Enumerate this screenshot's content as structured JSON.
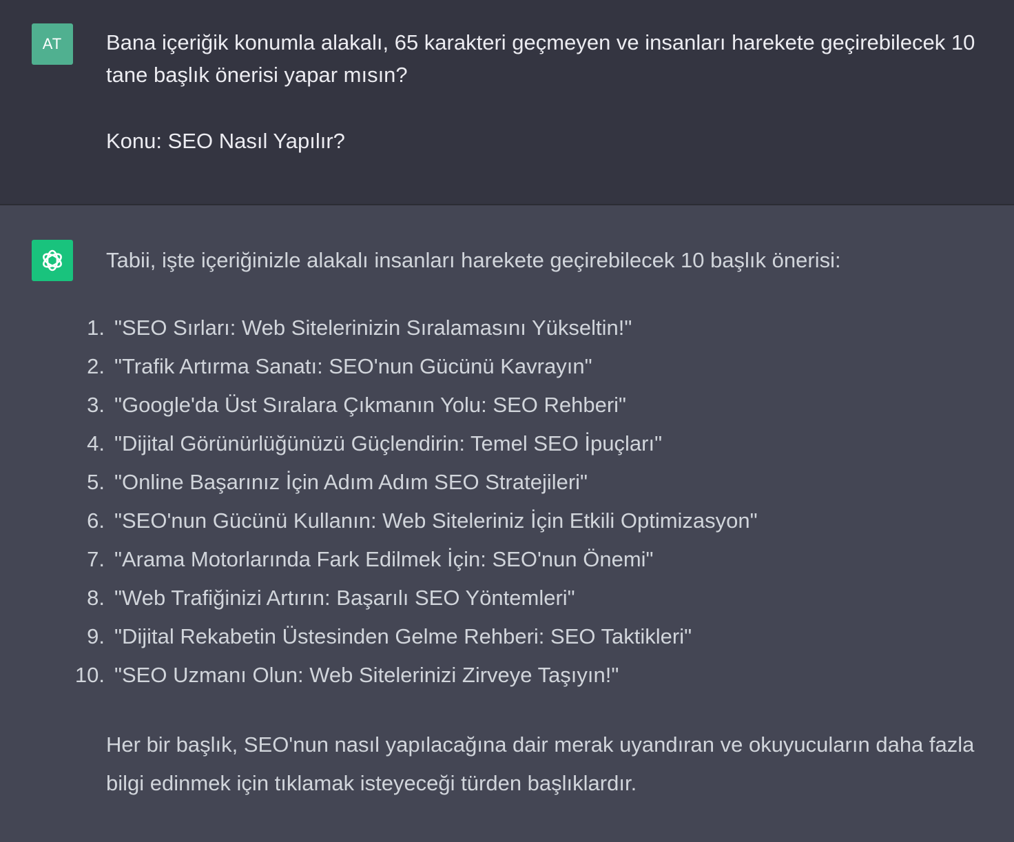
{
  "user_message": {
    "avatar_initials": "AT",
    "paragraph1": "Bana içeriğik konumla alakalı, 65 karakteri geçmeyen ve insanları harekete geçirebilecek 10 tane başlık önerisi yapar mısın?",
    "paragraph2": "Konu: SEO Nasıl Yapılır?"
  },
  "assistant_message": {
    "avatar_icon": "openai-logo-icon",
    "intro": "Tabii, işte içeriğinizle alakalı insanları harekete geçirebilecek 10 başlık önerisi:",
    "titles": [
      {
        "num": "1.",
        "text": "\"SEO Sırları: Web Sitelerinizin Sıralamasını Yükseltin!\""
      },
      {
        "num": "2.",
        "text": "\"Trafik Artırma Sanatı: SEO'nun Gücünü Kavrayın\""
      },
      {
        "num": "3.",
        "text": "\"Google'da Üst Sıralara Çıkmanın Yolu: SEO Rehberi\""
      },
      {
        "num": "4.",
        "text": "\"Dijital Görünürlüğünüzü Güçlendirin: Temel SEO İpuçları\""
      },
      {
        "num": "5.",
        "text": "\"Online Başarınız İçin Adım Adım SEO Stratejileri\""
      },
      {
        "num": "6.",
        "text": "\"SEO'nun Gücünü Kullanın: Web Siteleriniz İçin Etkili Optimizasyon\""
      },
      {
        "num": "7.",
        "text": "\"Arama Motorlarında Fark Edilmek İçin: SEO'nun Önemi\""
      },
      {
        "num": "8.",
        "text": "\"Web Trafiğinizi Artırın: Başarılı SEO Yöntemleri\""
      },
      {
        "num": "9.",
        "text": "\"Dijital Rekabetin Üstesinden Gelme Rehberi: SEO Taktikleri\""
      },
      {
        "num": "10.",
        "text": "\"SEO Uzmanı Olun: Web Sitelerinizi Zirveye Taşıyın!\""
      }
    ],
    "outro": "Her bir başlık, SEO'nun nasıl yapılacağına dair merak uyandıran ve okuyucuların daha fazla bilgi edinmek için tıklamak isteyeceği türden başlıklardır."
  },
  "colors": {
    "user_bg": "#343541",
    "assistant_bg": "#444654",
    "user_avatar": "#50b090",
    "bot_avatar": "#19c37d"
  }
}
